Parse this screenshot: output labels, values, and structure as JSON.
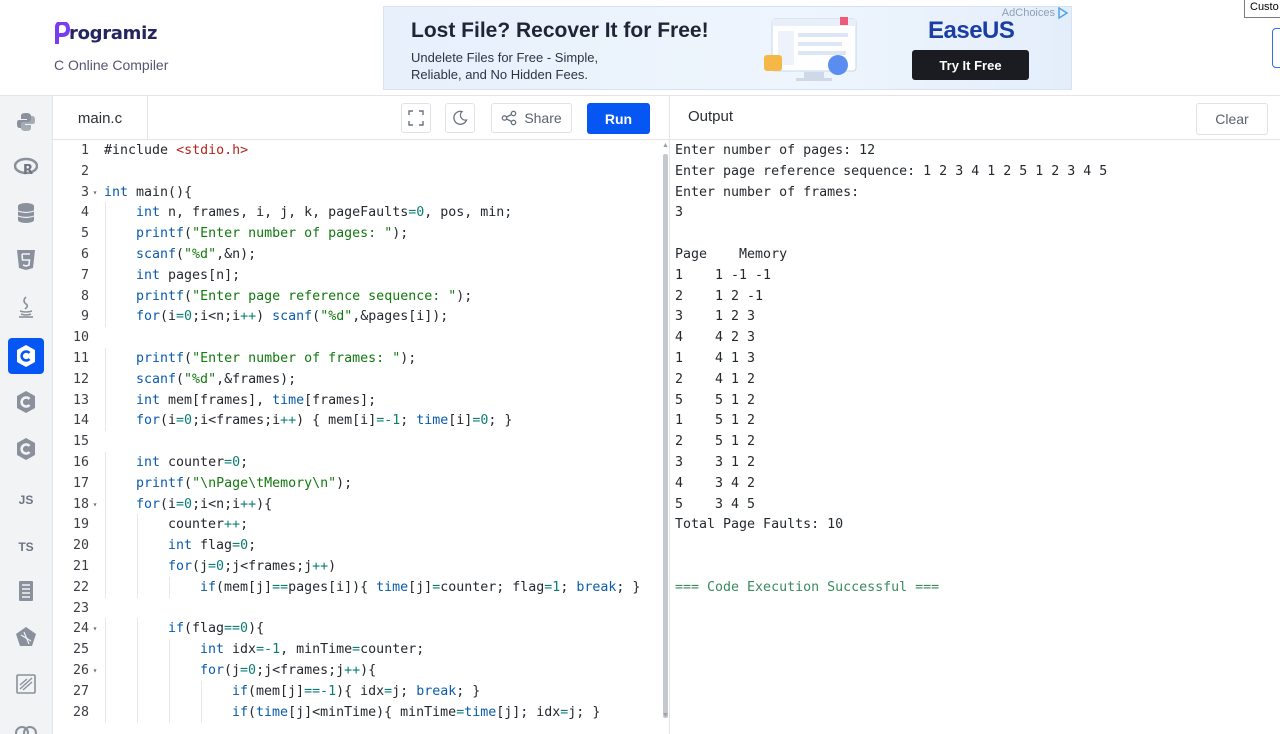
{
  "header": {
    "logo_text": "rogramiz",
    "subtitle": "C Online Compiler"
  },
  "ad": {
    "headline": "Lost File? Recover It for Free!",
    "body": "Undelete Files for Free - Simple, Reliable, and No Hidden Fees.",
    "ad_choices": "AdChoices",
    "brand": "EaseUS",
    "cta": "Try It Free"
  },
  "corner_button_label": "Custo",
  "sidebar": {
    "items": [
      {
        "name": "python-icon",
        "label": ""
      },
      {
        "name": "r-icon",
        "label": ""
      },
      {
        "name": "sql-icon",
        "label": ""
      },
      {
        "name": "html-icon",
        "label": ""
      },
      {
        "name": "java-icon",
        "label": ""
      },
      {
        "name": "c-icon",
        "label": "",
        "active": true
      },
      {
        "name": "cpp-icon",
        "label": ""
      },
      {
        "name": "csharp-icon",
        "label": ""
      },
      {
        "name": "js-icon",
        "label": "JS"
      },
      {
        "name": "ts-icon",
        "label": "TS"
      },
      {
        "name": "go-icon",
        "label": ""
      },
      {
        "name": "php-icon",
        "label": ""
      },
      {
        "name": "swift-icon",
        "label": ""
      },
      {
        "name": "rust-icon",
        "label": ""
      }
    ]
  },
  "editor": {
    "file_name": "main.c",
    "share_label": "Share",
    "run_label": "Run",
    "lines": [
      {
        "n": "1",
        "fold": false,
        "indent": 0,
        "tokens": [
          [
            "p",
            "#include "
          ],
          [
            "inc",
            "<stdio.h>"
          ]
        ]
      },
      {
        "n": "2",
        "fold": false,
        "indent": 0,
        "tokens": []
      },
      {
        "n": "3",
        "fold": true,
        "indent": 0,
        "tokens": [
          [
            "kw",
            "int"
          ],
          [
            "p",
            " main(){"
          ]
        ]
      },
      {
        "n": "4",
        "fold": false,
        "indent": 1,
        "tokens": [
          [
            "kw",
            "int"
          ],
          [
            "p",
            " n, frames, i, j, k, pageFaults"
          ],
          [
            "num",
            "=0"
          ],
          [
            "p",
            ", pos, min;"
          ]
        ]
      },
      {
        "n": "5",
        "fold": false,
        "indent": 1,
        "tokens": [
          [
            "kw",
            "printf"
          ],
          [
            "p",
            "("
          ],
          [
            "str",
            "\"Enter number of pages: \""
          ],
          [
            "p",
            ");"
          ]
        ]
      },
      {
        "n": "6",
        "fold": false,
        "indent": 1,
        "tokens": [
          [
            "kw",
            "scanf"
          ],
          [
            "p",
            "("
          ],
          [
            "str",
            "\"%d\""
          ],
          [
            "p",
            ",&n);"
          ]
        ]
      },
      {
        "n": "7",
        "fold": false,
        "indent": 1,
        "tokens": [
          [
            "kw",
            "int"
          ],
          [
            "p",
            " pages[n];"
          ]
        ]
      },
      {
        "n": "8",
        "fold": false,
        "indent": 1,
        "tokens": [
          [
            "kw",
            "printf"
          ],
          [
            "p",
            "("
          ],
          [
            "str",
            "\"Enter page reference sequence: \""
          ],
          [
            "p",
            ");"
          ]
        ]
      },
      {
        "n": "9",
        "fold": false,
        "indent": 1,
        "tokens": [
          [
            "kw",
            "for"
          ],
          [
            "p",
            "(i"
          ],
          [
            "num",
            "=0"
          ],
          [
            "p",
            ";i<n;i"
          ],
          [
            "num",
            "++"
          ],
          [
            "p",
            ") "
          ],
          [
            "kw",
            "scanf"
          ],
          [
            "p",
            "("
          ],
          [
            "str",
            "\"%d\""
          ],
          [
            "p",
            ",&pages[i]);"
          ]
        ]
      },
      {
        "n": "10",
        "fold": false,
        "indent": 0,
        "tokens": []
      },
      {
        "n": "11",
        "fold": false,
        "indent": 1,
        "tokens": [
          [
            "kw",
            "printf"
          ],
          [
            "p",
            "("
          ],
          [
            "str",
            "\"Enter number of frames: \""
          ],
          [
            "p",
            ");"
          ]
        ]
      },
      {
        "n": "12",
        "fold": false,
        "indent": 1,
        "tokens": [
          [
            "kw",
            "scanf"
          ],
          [
            "p",
            "("
          ],
          [
            "str",
            "\"%d\""
          ],
          [
            "p",
            ",&frames);"
          ]
        ]
      },
      {
        "n": "13",
        "fold": false,
        "indent": 1,
        "tokens": [
          [
            "kw",
            "int"
          ],
          [
            "p",
            " mem[frames], "
          ],
          [
            "kw",
            "time"
          ],
          [
            "p",
            "[frames];"
          ]
        ]
      },
      {
        "n": "14",
        "fold": false,
        "indent": 1,
        "tokens": [
          [
            "kw",
            "for"
          ],
          [
            "p",
            "(i"
          ],
          [
            "num",
            "=0"
          ],
          [
            "p",
            ";i<frames;i"
          ],
          [
            "num",
            "++"
          ],
          [
            "p",
            ") { mem[i]"
          ],
          [
            "num",
            "=-1"
          ],
          [
            "p",
            "; "
          ],
          [
            "kw",
            "time"
          ],
          [
            "p",
            "[i]"
          ],
          [
            "num",
            "=0"
          ],
          [
            "p",
            "; }"
          ]
        ]
      },
      {
        "n": "15",
        "fold": false,
        "indent": 0,
        "tokens": []
      },
      {
        "n": "16",
        "fold": false,
        "indent": 1,
        "tokens": [
          [
            "kw",
            "int"
          ],
          [
            "p",
            " counter"
          ],
          [
            "num",
            "=0"
          ],
          [
            "p",
            ";"
          ]
        ]
      },
      {
        "n": "17",
        "fold": false,
        "indent": 1,
        "tokens": [
          [
            "kw",
            "printf"
          ],
          [
            "p",
            "("
          ],
          [
            "str",
            "\"\\nPage\\tMemory\\n\""
          ],
          [
            "p",
            ");"
          ]
        ]
      },
      {
        "n": "18",
        "fold": true,
        "indent": 1,
        "tokens": [
          [
            "kw",
            "for"
          ],
          [
            "p",
            "(i"
          ],
          [
            "num",
            "=0"
          ],
          [
            "p",
            ";i<n;i"
          ],
          [
            "num",
            "++"
          ],
          [
            "p",
            "){"
          ]
        ]
      },
      {
        "n": "19",
        "fold": false,
        "indent": 2,
        "tokens": [
          [
            "p",
            "counter"
          ],
          [
            "num",
            "++"
          ],
          [
            "p",
            ";"
          ]
        ]
      },
      {
        "n": "20",
        "fold": false,
        "indent": 2,
        "tokens": [
          [
            "kw",
            "int"
          ],
          [
            "p",
            " flag"
          ],
          [
            "num",
            "=0"
          ],
          [
            "p",
            ";"
          ]
        ]
      },
      {
        "n": "21",
        "fold": false,
        "indent": 2,
        "tokens": [
          [
            "kw",
            "for"
          ],
          [
            "p",
            "(j"
          ],
          [
            "num",
            "=0"
          ],
          [
            "p",
            ";j<frames;j"
          ],
          [
            "num",
            "++"
          ],
          [
            "p",
            ")"
          ]
        ]
      },
      {
        "n": "22",
        "fold": false,
        "indent": 3,
        "tokens": [
          [
            "kw",
            "if"
          ],
          [
            "p",
            "(mem[j]"
          ],
          [
            "num",
            "=="
          ],
          [
            "p",
            "pages[i]){ "
          ],
          [
            "kw",
            "time"
          ],
          [
            "p",
            "[j]"
          ],
          [
            "num",
            "="
          ],
          [
            "p",
            "counter; flag"
          ],
          [
            "num",
            "=1"
          ],
          [
            "p",
            "; "
          ],
          [
            "kw",
            "break"
          ],
          [
            "p",
            "; }"
          ]
        ]
      },
      {
        "n": "23",
        "fold": false,
        "indent": 0,
        "tokens": []
      },
      {
        "n": "24",
        "fold": true,
        "indent": 2,
        "tokens": [
          [
            "kw",
            "if"
          ],
          [
            "p",
            "(flag"
          ],
          [
            "num",
            "==0"
          ],
          [
            "p",
            "){"
          ]
        ]
      },
      {
        "n": "25",
        "fold": false,
        "indent": 3,
        "tokens": [
          [
            "kw",
            "int"
          ],
          [
            "p",
            " idx"
          ],
          [
            "num",
            "=-1"
          ],
          [
            "p",
            ", minTime"
          ],
          [
            "num",
            "="
          ],
          [
            "p",
            "counter;"
          ]
        ]
      },
      {
        "n": "26",
        "fold": true,
        "indent": 3,
        "tokens": [
          [
            "kw",
            "for"
          ],
          [
            "p",
            "(j"
          ],
          [
            "num",
            "=0"
          ],
          [
            "p",
            ";j<frames;j"
          ],
          [
            "num",
            "++"
          ],
          [
            "p",
            "){"
          ]
        ]
      },
      {
        "n": "27",
        "fold": false,
        "indent": 4,
        "tokens": [
          [
            "kw",
            "if"
          ],
          [
            "p",
            "(mem[j]"
          ],
          [
            "num",
            "==-1"
          ],
          [
            "p",
            "){ idx"
          ],
          [
            "num",
            "="
          ],
          [
            "p",
            "j; "
          ],
          [
            "kw",
            "break"
          ],
          [
            "p",
            "; }"
          ]
        ]
      },
      {
        "n": "28",
        "fold": false,
        "indent": 4,
        "tokens": [
          [
            "kw",
            "if"
          ],
          [
            "p",
            "("
          ],
          [
            "kw",
            "time"
          ],
          [
            "p",
            "[j]<minTime){ minTime"
          ],
          [
            "num",
            "="
          ],
          [
            "kw",
            "time"
          ],
          [
            "p",
            "[j]; idx"
          ],
          [
            "num",
            "="
          ],
          [
            "p",
            "j; }"
          ]
        ]
      }
    ]
  },
  "output": {
    "title": "Output",
    "clear_label": "Clear",
    "lines": [
      {
        "text": "Enter number of pages: 12",
        "type": "normal"
      },
      {
        "text": "Enter page reference sequence: 1 2 3 4 1 2 5 1 2 3 4 5",
        "type": "normal"
      },
      {
        "text": "Enter number of frames:",
        "type": "normal"
      },
      {
        "text": "3",
        "type": "normal"
      },
      {
        "text": "",
        "type": "normal"
      },
      {
        "text": "Page    Memory",
        "type": "normal"
      },
      {
        "text": "1    1 -1 -1",
        "type": "normal"
      },
      {
        "text": "2    1 2 -1",
        "type": "normal"
      },
      {
        "text": "3    1 2 3",
        "type": "normal"
      },
      {
        "text": "4    4 2 3",
        "type": "normal"
      },
      {
        "text": "1    4 1 3",
        "type": "normal"
      },
      {
        "text": "2    4 1 2",
        "type": "normal"
      },
      {
        "text": "5    5 1 2",
        "type": "normal"
      },
      {
        "text": "1    5 1 2",
        "type": "normal"
      },
      {
        "text": "2    5 1 2",
        "type": "normal"
      },
      {
        "text": "3    3 1 2",
        "type": "normal"
      },
      {
        "text": "4    3 4 2",
        "type": "normal"
      },
      {
        "text": "5    3 4 5",
        "type": "normal"
      },
      {
        "text": "Total Page Faults: 10",
        "type": "normal"
      },
      {
        "text": "",
        "type": "normal"
      },
      {
        "text": "",
        "type": "normal"
      },
      {
        "text": "=== Code Execution Successful ===",
        "type": "success"
      }
    ]
  },
  "colors": {
    "accent": "#0556f3",
    "keyword": "#0b5cab",
    "string": "#12780f",
    "include": "#b3261e",
    "number": "#0a7e74",
    "success": "#3a8a5c"
  }
}
